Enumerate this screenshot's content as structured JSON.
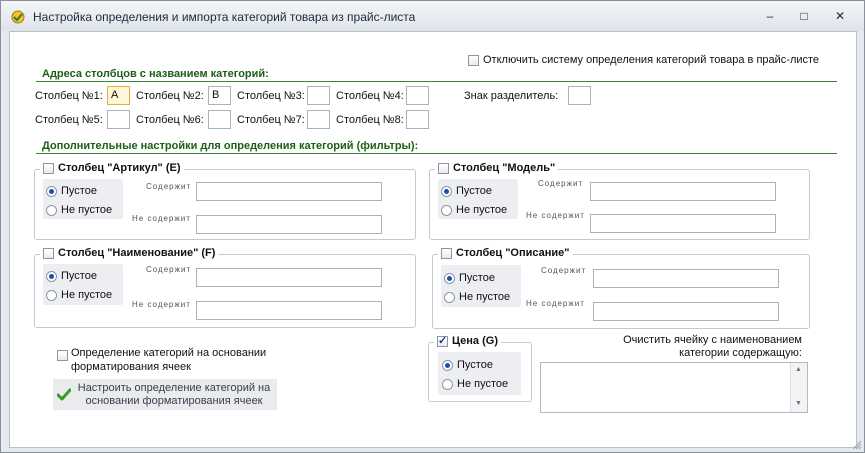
{
  "window": {
    "title": "Настройка определения и импорта категорий товара из прайс-листа"
  },
  "disable_checkbox": {
    "label": "Отключить систему определения категорий товара в прайс-листе",
    "checked": false
  },
  "addresses": {
    "header": "Адреса столбцов с названием категорий:",
    "cols": [
      {
        "label": "Столбец №1:",
        "value": "A"
      },
      {
        "label": "Столбец №2:",
        "value": "B"
      },
      {
        "label": "Столбец №3:",
        "value": ""
      },
      {
        "label": "Столбец №4:",
        "value": ""
      },
      {
        "label": "Столбец №5:",
        "value": ""
      },
      {
        "label": "Столбец №6:",
        "value": ""
      },
      {
        "label": "Столбец №7:",
        "value": ""
      },
      {
        "label": "Столбец №8:",
        "value": ""
      }
    ],
    "separator_label": "Знак разделитель:",
    "separator_value": ""
  },
  "filters_header": "Дополнительные настройки для определения категорий (фильтры):",
  "common": {
    "empty": "Пустое",
    "not_empty": "Не пустое",
    "contains": "Содержит",
    "not_contains": "Не содержит"
  },
  "groups": {
    "articul": {
      "title": "Столбец \"Артикул\" (E)"
    },
    "model": {
      "title": "Столбец \"Модель\""
    },
    "name": {
      "title": "Столбец \"Наименование\" (F)"
    },
    "descr": {
      "title": "Столбец \"Описание\""
    },
    "price": {
      "title": "Цена (G)",
      "checked": true
    }
  },
  "format_checkbox": {
    "label_line1": "Определение категорий на основании",
    "label_line2": "форматирования ячеек"
  },
  "format_button": {
    "line1": "Настроить определение категорий на",
    "line2": "основании форматирования ячеек"
  },
  "clear": {
    "line1": "Очистить ячейку с наименованием",
    "line2": "категории содержащую:",
    "value": ""
  },
  "colors": {
    "accent_green": "#1d5e17",
    "rule": "#2f8a2f"
  }
}
